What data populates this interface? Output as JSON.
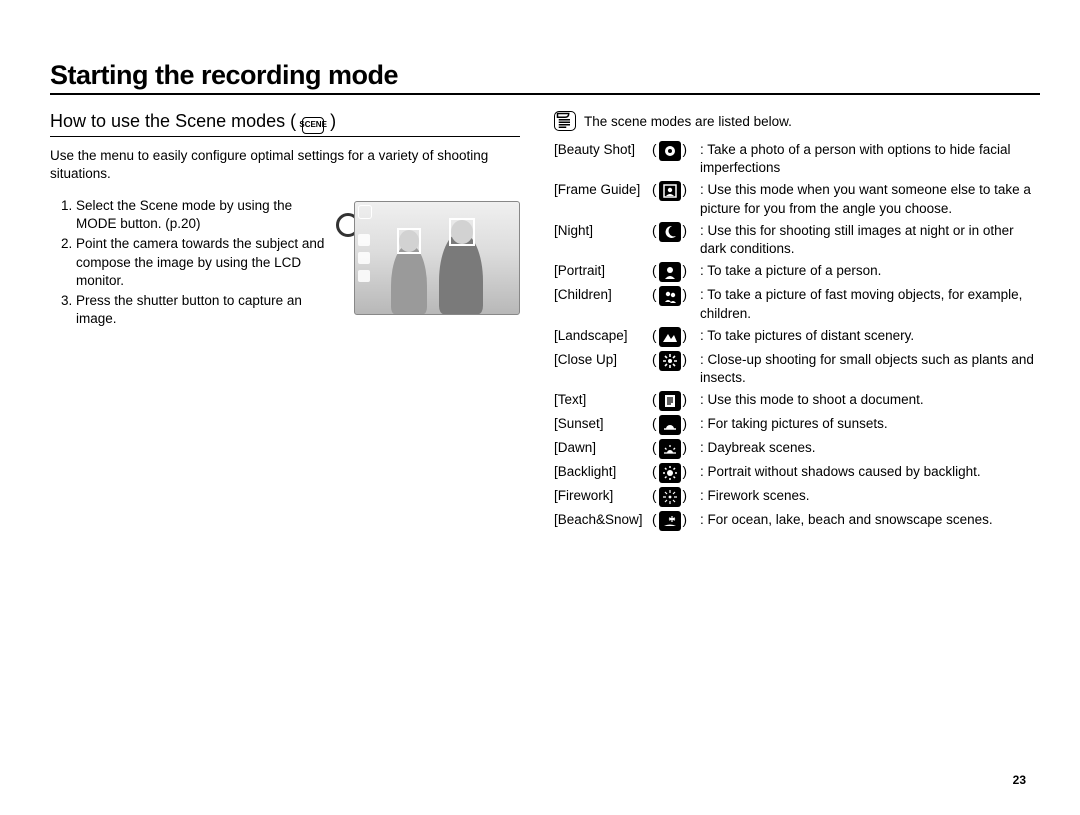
{
  "title": "Starting the recording mode",
  "left": {
    "subhead": "How to use the Scene modes (",
    "subhead_close": ")",
    "scene_chip": "SCENE",
    "intro": "Use the menu to easily configure optimal settings for a variety of shooting situations.",
    "steps": [
      "Select the Scene mode by using the MODE button. (p.20)",
      "Point the camera towards the subject and compose the image by using the LCD monitor.",
      "Press the shutter button to capture an image."
    ]
  },
  "right": {
    "note": "The scene modes are listed below.",
    "modes": [
      {
        "label": "[Beauty Shot]",
        "icon": "beauty",
        "desc": "Take a photo of a person with options to hide facial imperfections"
      },
      {
        "label": "[Frame Guide]",
        "icon": "frame",
        "desc": "Use this mode when you want someone else to take a picture for you from the angle you choose."
      },
      {
        "label": "[Night]",
        "icon": "night",
        "desc": "Use this for shooting still images at night or in other dark conditions."
      },
      {
        "label": "[Portrait]",
        "icon": "portrait",
        "desc": "To take a picture of a person."
      },
      {
        "label": "[Children]",
        "icon": "children",
        "desc": "To take a picture of fast moving objects, for example, children."
      },
      {
        "label": "[Landscape]",
        "icon": "landscape",
        "desc": "To take pictures of distant scenery."
      },
      {
        "label": "[Close Up]",
        "icon": "closeup",
        "desc": "Close-up shooting for small objects such as plants and insects."
      },
      {
        "label": "[Text]",
        "icon": "text",
        "desc": "Use this mode to shoot a document."
      },
      {
        "label": "[Sunset]",
        "icon": "sunset",
        "desc": "For taking pictures of sunsets."
      },
      {
        "label": "[Dawn]",
        "icon": "dawn",
        "desc": "Daybreak scenes."
      },
      {
        "label": "[Backlight]",
        "icon": "backlight",
        "desc": "Portrait without shadows caused by backlight."
      },
      {
        "label": "[Firework]",
        "icon": "firework",
        "desc": "Firework scenes."
      },
      {
        "label": "[Beach&Snow]",
        "icon": "beachsnow",
        "desc": "For ocean, lake, beach and snowscape scenes."
      }
    ]
  },
  "page_number": "23",
  "icon_glyphs": {
    "beauty": "✿",
    "frame": "▣",
    "night": "☽",
    "portrait": "☺",
    "children": "☻",
    "landscape": "▲",
    "closeup": "❀",
    "text": "≡",
    "sunset": "◓",
    "dawn": "✺",
    "backlight": "☀",
    "firework": "✶",
    "beachsnow": "❄"
  }
}
